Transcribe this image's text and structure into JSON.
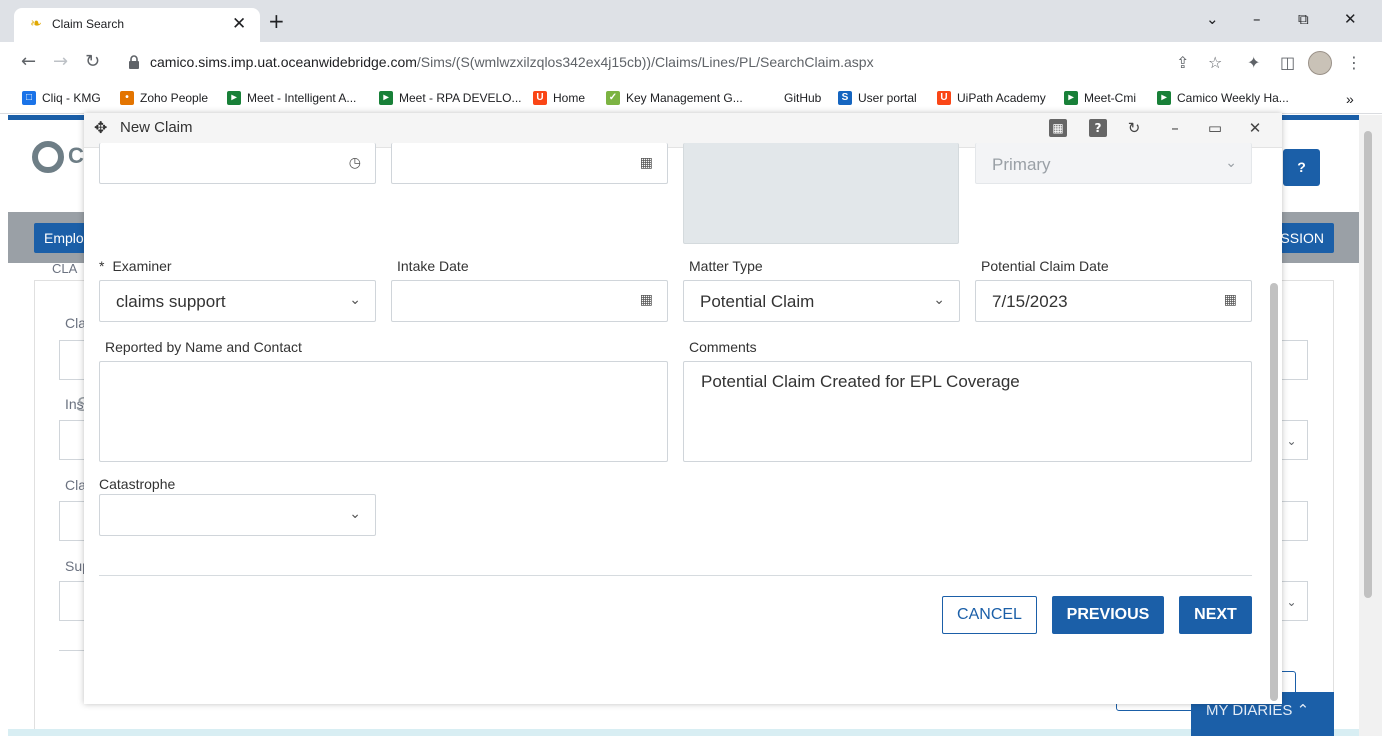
{
  "browser": {
    "tab_title": "Claim Search",
    "url_host": "camico.sims.imp.uat.oceanwidebridge.com",
    "url_path": "/Sims/(S(wmlwzxilzqlos342ex4j15cb))/Claims/Lines/PL/SearchClaim.aspx",
    "bookmarks": [
      {
        "label": "Cliq - KMG",
        "color": "#1a73e8"
      },
      {
        "label": "Zoho People",
        "color": "#e37400"
      },
      {
        "label": "Meet - Intelligent A...",
        "color": "#188038"
      },
      {
        "label": "Meet - RPA DEVELO...",
        "color": "#188038"
      },
      {
        "label": "Home",
        "color": "#fa4616"
      },
      {
        "label": "Key Management G...",
        "color": "#7cb342"
      },
      {
        "label": "GitHub",
        "color": "#ffffff"
      },
      {
        "label": "User portal",
        "color": "#1565c0"
      },
      {
        "label": "UiPath Academy",
        "color": "#fa4616"
      },
      {
        "label": "Meet-Cmi",
        "color": "#188038"
      },
      {
        "label": "Camico Weekly Ha...",
        "color": "#188038"
      }
    ],
    "bookmarks_more": "»"
  },
  "background_page": {
    "help_label": "?",
    "employee_button": "Emplo",
    "session_button": "SSION",
    "partial_labels": [
      "Cla",
      "Ins",
      "Cla",
      "Sup"
    ],
    "partial_section": "CLA",
    "italic_value": "S",
    "my_diaries": "MY DIARIES"
  },
  "modal": {
    "title": "New Claim",
    "top_row": {
      "field4_value": "Primary"
    },
    "examiner": {
      "label": "Examiner",
      "required_marker": "*",
      "value": "claims support"
    },
    "intake_date": {
      "label": "Intake Date",
      "value": ""
    },
    "matter_type": {
      "label": "Matter Type",
      "value": "Potential Claim"
    },
    "potential_claim_date": {
      "label": "Potential Claim Date",
      "value": "7/15/2023"
    },
    "reported_by": {
      "label": "Reported by Name and Contact",
      "value": ""
    },
    "comments": {
      "label": "Comments",
      "value": "Potential Claim Created for EPL Coverage"
    },
    "catastrophe": {
      "label": "Catastrophe",
      "value": ""
    },
    "buttons": {
      "cancel": "CANCEL",
      "previous": "PREVIOUS",
      "next": "NEXT"
    }
  },
  "colors": {
    "primary": "#1b5fa8",
    "border": "#d0d5da"
  }
}
